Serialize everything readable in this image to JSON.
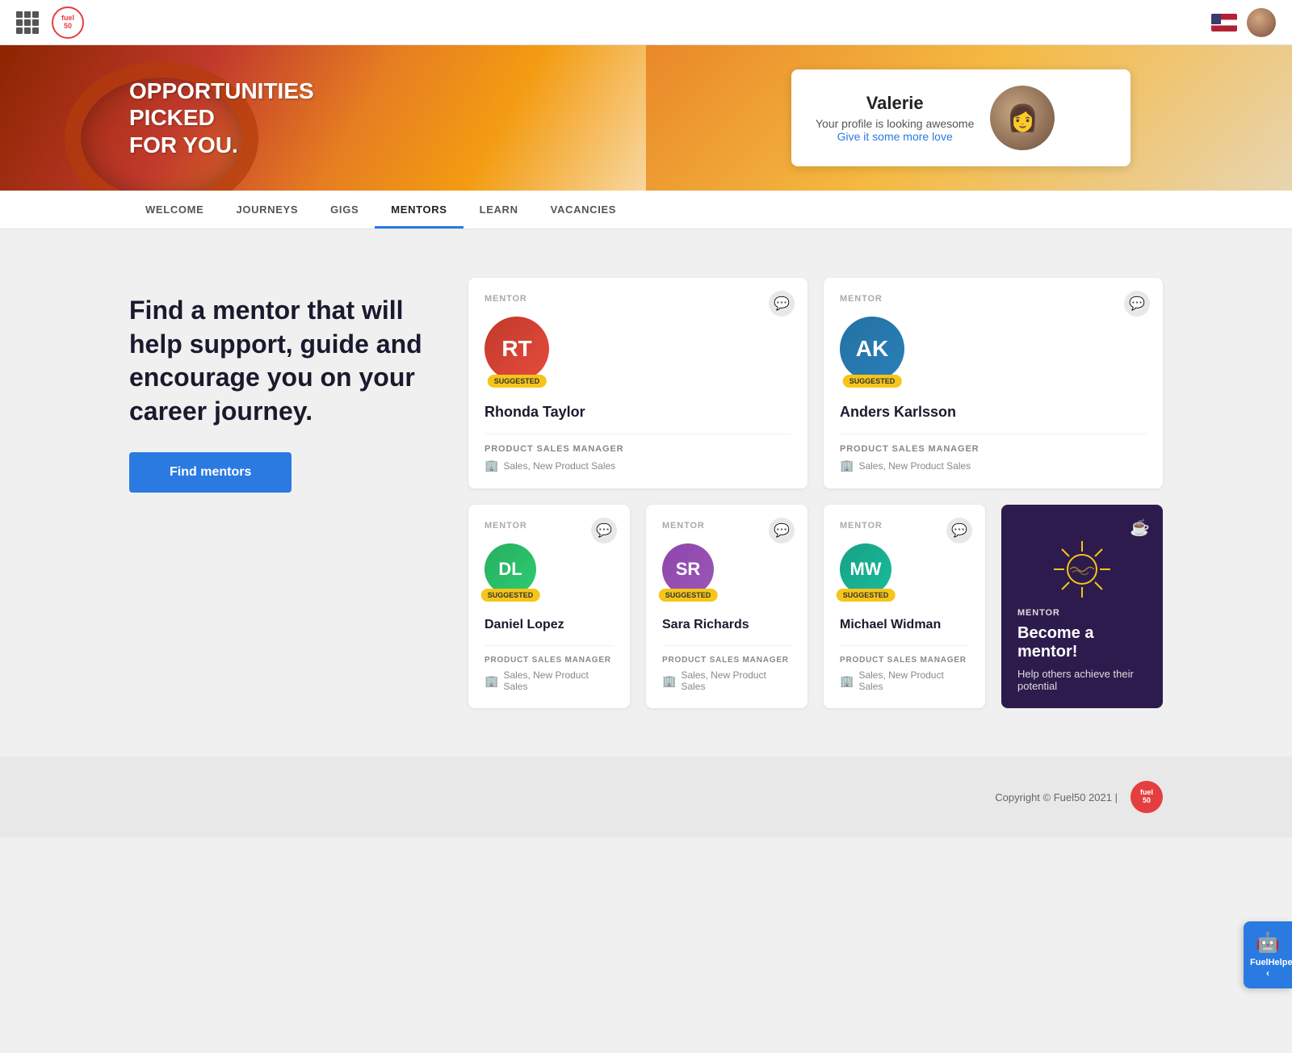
{
  "header": {
    "logo_text": "fuel\n50",
    "grid_label": "grid-menu"
  },
  "nav": {
    "items": [
      {
        "label": "WELCOME",
        "active": false
      },
      {
        "label": "JOURNEYS",
        "active": false
      },
      {
        "label": "GIGS",
        "active": false
      },
      {
        "label": "MENTORS",
        "active": true
      },
      {
        "label": "LEARN",
        "active": false
      },
      {
        "label": "VACANCIES",
        "active": false
      }
    ]
  },
  "hero": {
    "banner_line1": "OPPORTUNITIES PICKED",
    "banner_line2": "FOR YOU.",
    "user_name": "Valerie",
    "profile_subtitle": "Your profile is looking awesome",
    "profile_link": "Give it some more love"
  },
  "main": {
    "intro_heading": "Find a mentor that will help support, guide and encourage you on your career journey.",
    "find_button": "Find mentors",
    "mentors": [
      {
        "id": "rhonda",
        "label": "MENTOR",
        "name": "Rhonda Taylor",
        "role": "PRODUCT SALES MANAGER",
        "dept": "Sales, New Product Sales",
        "suggested": true,
        "avatar_color": "#c0392b",
        "avatar_text": "RT"
      },
      {
        "id": "anders",
        "label": "MENTOR",
        "name": "Anders Karlsson",
        "role": "PRODUCT SALES MANAGER",
        "dept": "Sales, New Product Sales",
        "suggested": true,
        "avatar_color": "#2980b9",
        "avatar_text": "AK"
      },
      {
        "id": "daniel",
        "label": "MENTOR",
        "name": "Daniel Lopez",
        "role": "PRODUCT SALES MANAGER",
        "dept": "Sales, New Product Sales",
        "suggested": true,
        "avatar_color": "#27ae60",
        "avatar_text": "DL"
      },
      {
        "id": "sara",
        "label": "MENTOR",
        "name": "Sara Richards",
        "role": "PRODUCT SALES MANAGER",
        "dept": "Sales, New Product Sales",
        "suggested": true,
        "avatar_color": "#8e44ad",
        "avatar_text": "SR"
      },
      {
        "id": "michael",
        "label": "MENTOR",
        "name": "Michael Widman",
        "role": "PRODUCT SALES MANAGER",
        "dept": "Sales, New Product Sales",
        "suggested": true,
        "avatar_color": "#16a085",
        "avatar_text": "MW"
      }
    ],
    "become_card": {
      "label": "MENTOR",
      "title": "Become a mentor!",
      "subtitle": "Help others achieve their potential"
    }
  },
  "footer": {
    "copyright": "Copyright © Fuel50 2021  |",
    "logo_text": "fuel\n50"
  },
  "fuel_helper": {
    "label": "FuelHelper"
  }
}
